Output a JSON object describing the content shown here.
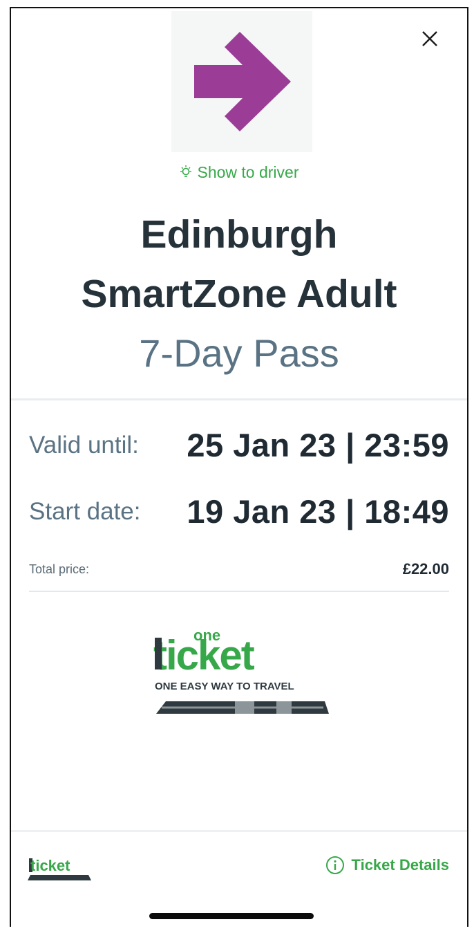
{
  "header": {
    "close_icon": "close-icon",
    "animation_icon": "arrow-right-icon",
    "arrow_color": "#9b3c97",
    "show_driver_label": "Show to driver"
  },
  "ticket": {
    "title_line1": "Edinburgh",
    "title_line2": "SmartZone Adult",
    "subtitle": "7-Day Pass",
    "valid_until_label": "Valid until:",
    "valid_until_value": "25 Jan 23 | 23:59",
    "start_date_label": "Start date:",
    "start_date_value": "19 Jan 23 | 18:49",
    "total_price_label": "Total price:",
    "total_price_value": "£22.00"
  },
  "brand": {
    "logo_word_one": "one",
    "logo_word_ticket": "ticket",
    "tagline": "ONE EASY WAY TO TRAVEL",
    "accent_color": "#37a84a"
  },
  "footer": {
    "details_label": "Ticket Details",
    "details_icon": "info-icon"
  }
}
